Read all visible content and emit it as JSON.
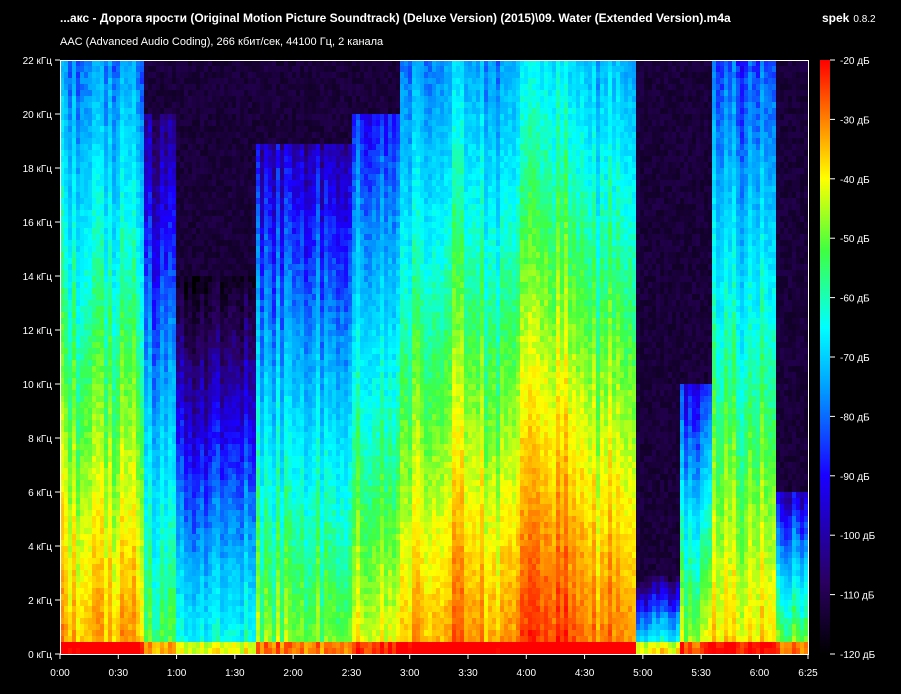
{
  "header": {
    "file_title": "...акс - Дорога ярости (Original Motion Picture Soundtrack) (Deluxe Version) (2015)\\09. Water (Extended Version).m4a",
    "app_name": "spek",
    "app_version": "0.8.2",
    "file_info": "AAC (Advanced Audio Coding), 266 кбит/сек, 44100 Гц, 2 канала"
  },
  "chart_data": {
    "type": "heatmap",
    "title": "",
    "xlabel": "",
    "ylabel": "",
    "x_ticks": [
      "0:00",
      "0:30",
      "1:00",
      "1:30",
      "2:00",
      "2:30",
      "3:00",
      "3:30",
      "4:00",
      "4:30",
      "5:00",
      "5:30",
      "6:00",
      "6:25"
    ],
    "x_tick_seconds": [
      0,
      30,
      60,
      90,
      120,
      150,
      180,
      210,
      240,
      270,
      300,
      330,
      360,
      385
    ],
    "xlim": [
      0,
      385
    ],
    "y_ticks": [
      "0 кГц",
      "2 кГц",
      "4 кГц",
      "6 кГц",
      "8 кГц",
      "10 кГц",
      "12 кГц",
      "14 кГц",
      "16 кГц",
      "18 кГц",
      "20 кГц",
      "22 кГц"
    ],
    "y_tick_khz": [
      0,
      2,
      4,
      6,
      8,
      10,
      12,
      14,
      16,
      18,
      20,
      22
    ],
    "ylim": [
      0,
      22
    ],
    "colorbar": {
      "ticks": [
        "-20 дБ",
        "-30 дБ",
        "-40 дБ",
        "-50 дБ",
        "-60 дБ",
        "-70 дБ",
        "-80 дБ",
        "-90 дБ",
        "-100 дБ",
        "-110 дБ",
        "-120 дБ"
      ],
      "tick_db": [
        -20,
        -30,
        -40,
        -50,
        -60,
        -70,
        -80,
        -90,
        -100,
        -110,
        -120
      ],
      "range_db": [
        -120,
        -20
      ],
      "palette": [
        "#000000",
        "#2a0060",
        "#1a00ff",
        "#00a0ff",
        "#00ffff",
        "#40ff40",
        "#ffff00",
        "#ff8000",
        "#ff0000"
      ]
    },
    "segments": [
      {
        "t0": 0,
        "t1": 3,
        "top_khz": 22,
        "level": 0.62
      },
      {
        "t0": 3,
        "t1": 42,
        "top_khz": 22,
        "level": 0.55
      },
      {
        "t0": 42,
        "t1": 58,
        "top_khz": 20,
        "level": 0.35
      },
      {
        "t0": 58,
        "t1": 100,
        "top_khz": 14,
        "level": 0.25
      },
      {
        "t0": 100,
        "t1": 150,
        "top_khz": 19,
        "level": 0.4
      },
      {
        "t0": 150,
        "t1": 175,
        "top_khz": 20,
        "level": 0.48
      },
      {
        "t0": 175,
        "t1": 198,
        "top_khz": 22,
        "level": 0.55
      },
      {
        "t0": 198,
        "t1": 215,
        "top_khz": 22,
        "level": 0.62
      },
      {
        "t0": 215,
        "t1": 235,
        "top_khz": 22,
        "level": 0.58
      },
      {
        "t0": 235,
        "t1": 270,
        "top_khz": 22,
        "level": 0.66
      },
      {
        "t0": 270,
        "t1": 296,
        "top_khz": 22,
        "level": 0.6
      },
      {
        "t0": 296,
        "t1": 318,
        "top_khz": 3,
        "level": 0.3
      },
      {
        "t0": 318,
        "t1": 335,
        "top_khz": 10,
        "level": 0.45
      },
      {
        "t0": 335,
        "t1": 368,
        "top_khz": 22,
        "level": 0.5
      },
      {
        "t0": 368,
        "t1": 385,
        "top_khz": 6,
        "level": 0.4
      }
    ]
  }
}
